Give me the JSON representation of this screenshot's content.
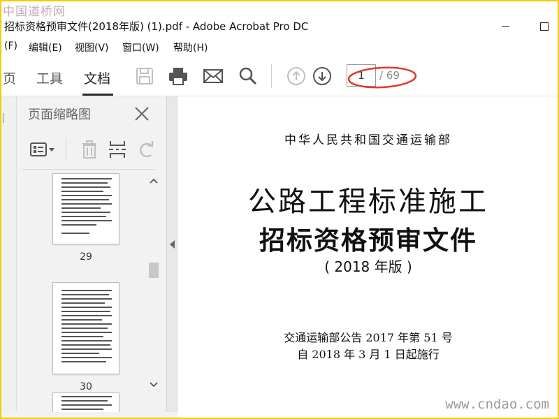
{
  "watermarks": {
    "top": "中国道桥网",
    "bottom": "www.cndao.com"
  },
  "window": {
    "title": "招标资格预审文件(2018年版) (1).pdf - Adobe Acrobat Pro DC"
  },
  "menu": [
    {
      "label": "(F)"
    },
    {
      "label": "编辑(E)"
    },
    {
      "label": "视图(V)"
    },
    {
      "label": "窗口(W)"
    },
    {
      "label": "帮助(H)"
    }
  ],
  "toolbar": {
    "tabs": [
      {
        "label": "页"
      },
      {
        "label": "工具"
      },
      {
        "label": "文档"
      }
    ],
    "active_tab": "文档",
    "icons": [
      "save-icon",
      "print-icon",
      "email-icon",
      "search-icon",
      "page-up-icon",
      "page-down-icon"
    ],
    "current_page": "1",
    "page_total": "/ 69"
  },
  "panel": {
    "title": "页面缩略图",
    "icons": [
      "page-options-icon",
      "trash-icon",
      "insert-pages-icon",
      "rotate-icon",
      "close-icon"
    ],
    "thumbnails": [
      {
        "label": "29"
      },
      {
        "label": "30"
      }
    ]
  },
  "document": {
    "ministry": "中华人民共和国交通运输部",
    "title_line1": "公路工程标准施工",
    "title_line2": "招标资格预审文件",
    "edition": "( 2018 年版 )",
    "notice": "交通运输部公告 2017 年第 51 号",
    "effective_date": "自 2018 年 3 月 1 日起施行"
  },
  "colors": {
    "frame": "#f0d000",
    "annotation": "#e0392b",
    "panel_bg": "#f2f2f2",
    "disabled_icon": "#c0c0c0"
  }
}
